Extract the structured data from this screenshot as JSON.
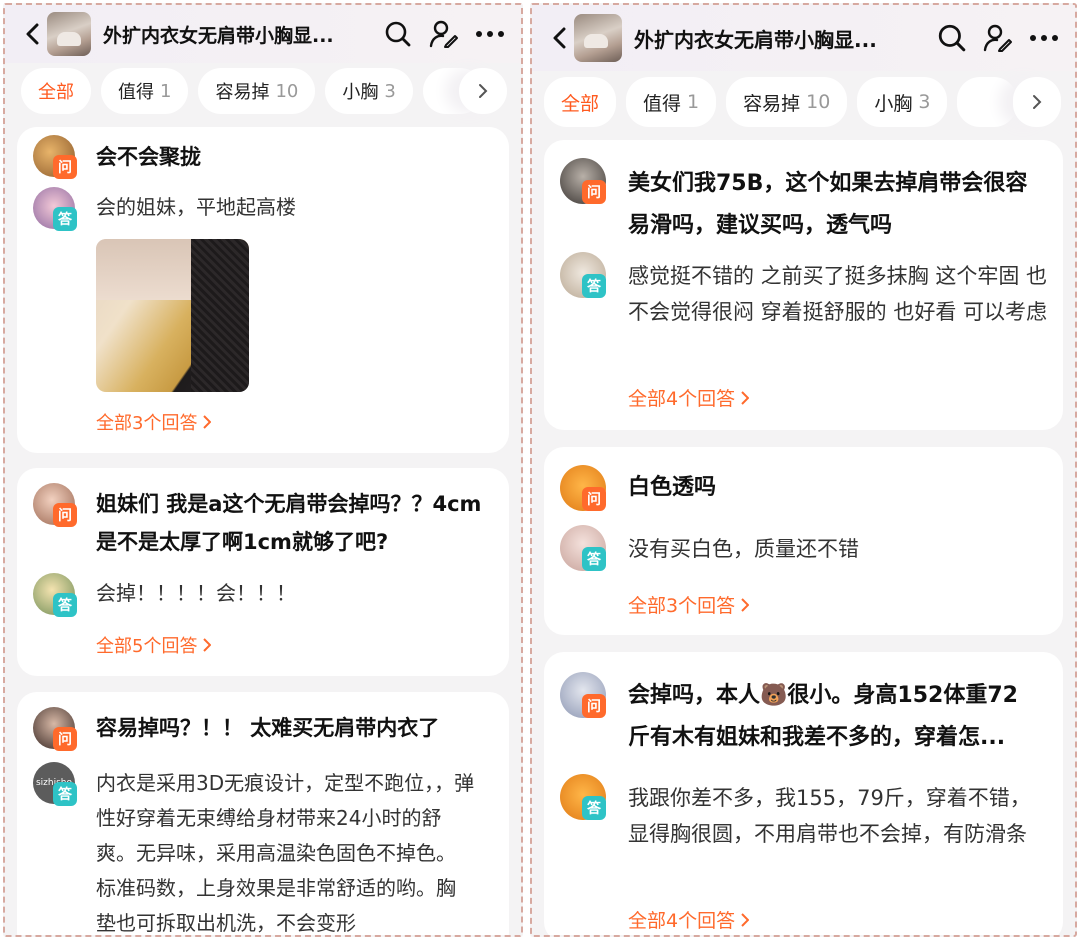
{
  "left": {
    "title": "外扩内衣女无肩带小胸显...",
    "tabs": [
      {
        "label": "全部",
        "count": ""
      },
      {
        "label": "值得",
        "count": "1"
      },
      {
        "label": "容易掉",
        "count": "10"
      },
      {
        "label": "小胸",
        "count": "3"
      }
    ],
    "qa": [
      {
        "q": "会不会聚拢",
        "a": "会的姐妹，平地起高楼",
        "more": "全部3个回答"
      },
      {
        "q": "姐妹们 我是a这个无肩带会掉吗？？4cm是不是太厚了啊1cm就够了吧?",
        "a": "会掉！！！！会！！！",
        "more": "全部5个回答"
      },
      {
        "q": "容易掉吗？！！ 太难买无肩带内衣了",
        "a": "内衣是采用3D无痕设计，定型不跑位，，弹性好穿着无束缚给身材带来24小时的舒爽。无异味，采用高温染色固色不掉色。标准码数，上身效果是非常舒适的哟。胸垫也可拆取出机洗，不会变形",
        "avatar_text": "sizhisho"
      }
    ]
  },
  "right": {
    "title": "外扩内衣女无肩带小胸显...",
    "tabs": [
      {
        "label": "全部",
        "count": ""
      },
      {
        "label": "值得",
        "count": "1"
      },
      {
        "label": "容易掉",
        "count": "10"
      },
      {
        "label": "小胸",
        "count": "3"
      }
    ],
    "qa": [
      {
        "q": "美女们我75B，这个如果去掉肩带会很容易滑吗，建议买吗，透气吗",
        "a": "感觉挺不错的  之前买了挺多抹胸 这个牢固 也不会觉得很闷 穿着挺舒服的  也好看  可以考虑",
        "more": "全部4个回答"
      },
      {
        "q": "白色透吗",
        "a": "没有买白色，质量还不错",
        "more": "全部3个回答"
      },
      {
        "q": "会掉吗，本人🐻很小。身高152体重72斤有木有姐妹和我差不多的，穿着怎...",
        "a": "我跟你差不多，我155，79斤，穿着不错，显得胸很圆，不用肩带也不会掉，有防滑条",
        "more": "全部4个回答"
      }
    ]
  },
  "badges": {
    "question": "问",
    "answer": "答"
  },
  "colors": {
    "accent": "#ff6a2c",
    "answer_badge": "#2ec3c6",
    "background": "#f4f3f4"
  }
}
